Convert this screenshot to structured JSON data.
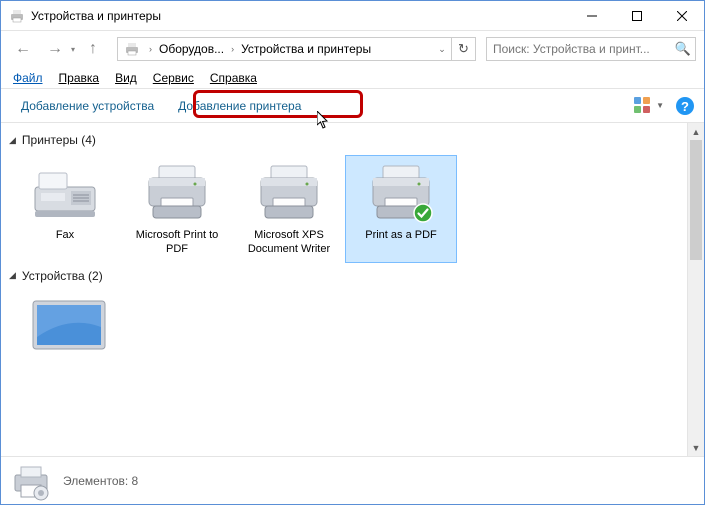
{
  "window": {
    "title": "Устройства и принтеры"
  },
  "breadcrumb": {
    "level1": "Оборудов...",
    "level2": "Устройства и принтеры"
  },
  "search": {
    "placeholder": "Поиск: Устройства и принт..."
  },
  "menu": {
    "file": "Файл",
    "edit": "Правка",
    "view": "Вид",
    "tools": "Сервис",
    "help": "Справка"
  },
  "toolbar": {
    "add_device": "Добавление устройства",
    "add_printer": "Добавление принтера"
  },
  "groups": {
    "printers": {
      "label": "Принтеры",
      "count": "(4)"
    },
    "devices": {
      "label": "Устройства",
      "count": "(2)"
    }
  },
  "printers": [
    {
      "name": "Fax"
    },
    {
      "name": "Microsoft Print to PDF"
    },
    {
      "name": "Microsoft XPS Document Writer"
    },
    {
      "name": "Print as a PDF"
    }
  ],
  "status": {
    "label": "Элементов:",
    "count": "8"
  }
}
